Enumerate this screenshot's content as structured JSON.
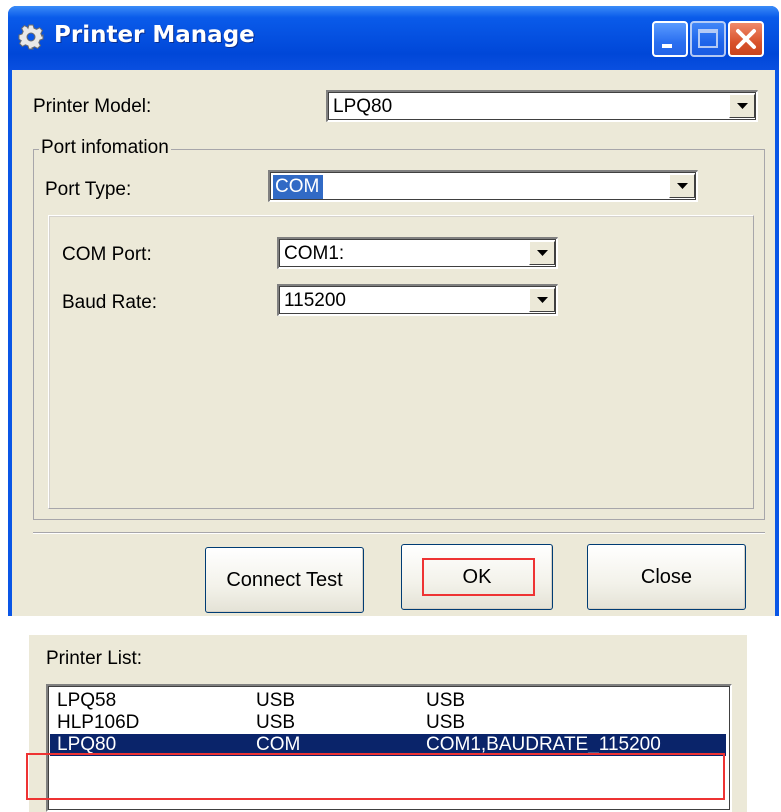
{
  "dialog": {
    "title": "Printer Manage",
    "title_icon": "gear-icon",
    "printer_model_label": "Printer Model:",
    "printer_model_value": "LPQ80",
    "port_group_label": "Port infomation",
    "port_type_label": "Port Type:",
    "port_type_value": "COM",
    "com_port_label": "COM Port:",
    "com_port_value": "COM1:",
    "baud_rate_label": "Baud Rate:",
    "baud_rate_value": "115200",
    "buttons": {
      "connect_test": "Connect Test",
      "ok": "OK",
      "close": "Close"
    }
  },
  "printer_list": {
    "label": "Printer List:",
    "rows": [
      {
        "model": "LPQ58",
        "type": "USB",
        "detail": "USB",
        "selected": false
      },
      {
        "model": "HLP106D",
        "type": "USB",
        "detail": "USB",
        "selected": false
      },
      {
        "model": "LPQ80",
        "type": "COM",
        "detail": "COM1,BAUDRATE_115200",
        "selected": true
      }
    ]
  },
  "colors": {
    "titlebar": "#0a56e6",
    "dialog_bg": "#ece9d8",
    "selection": "#0a246a",
    "combo_selection": "#316ac5",
    "highlight_marker": "#ee3333"
  }
}
